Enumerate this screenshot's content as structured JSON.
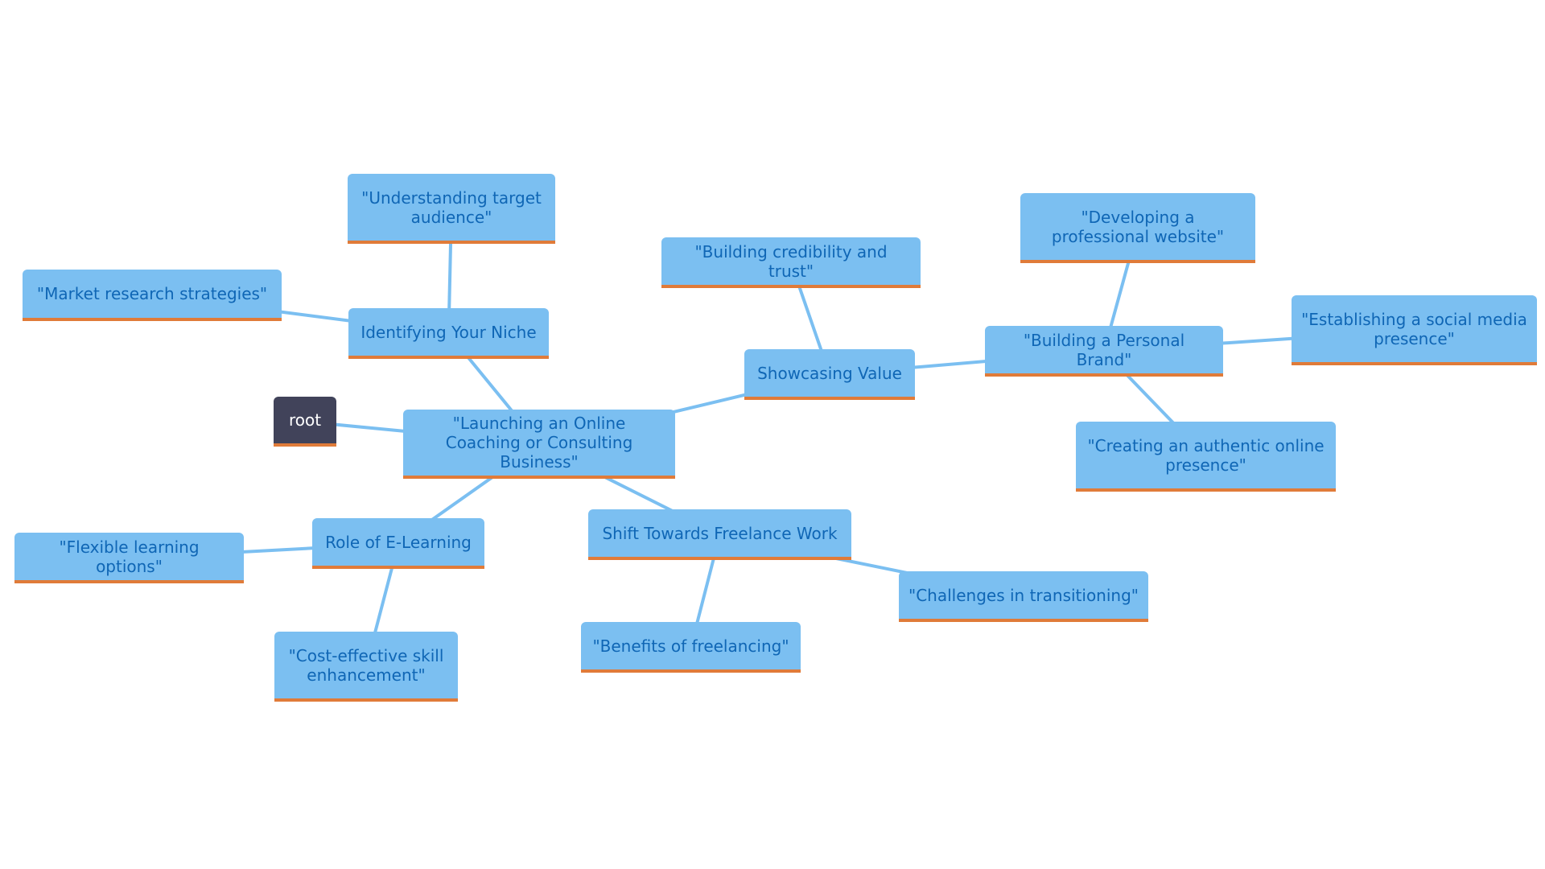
{
  "diagram": {
    "type": "mindmap",
    "colors": {
      "node_fill": "#7bbff1",
      "node_text": "#0f66b5",
      "node_underline": "#e07b39",
      "edge": "#7bbff1",
      "root_fill": "#41435a",
      "root_text": "#ffffff"
    },
    "nodes": [
      {
        "id": "root",
        "label": "root"
      },
      {
        "id": "center",
        "label": "\"Launching an Online Coaching or Consulting Business\""
      },
      {
        "id": "niche",
        "label": "Identifying Your Niche"
      },
      {
        "id": "audience",
        "label": "\"Understanding target audience\""
      },
      {
        "id": "market",
        "label": "\"Market research strategies\""
      },
      {
        "id": "elearn",
        "label": "Role of E-Learning"
      },
      {
        "id": "flexible",
        "label": "\"Flexible learning options\""
      },
      {
        "id": "cost",
        "label": "\"Cost-effective skill enhancement\""
      },
      {
        "id": "freelance",
        "label": "Shift Towards Freelance Work"
      },
      {
        "id": "benefits",
        "label": "\"Benefits of freelancing\""
      },
      {
        "id": "challenges",
        "label": "\"Challenges in transitioning\""
      },
      {
        "id": "value",
        "label": "Showcasing Value"
      },
      {
        "id": "credibility",
        "label": "\"Building credibility and trust\""
      },
      {
        "id": "brand",
        "label": "\"Building a Personal Brand\""
      },
      {
        "id": "website",
        "label": "\"Developing a professional website\""
      },
      {
        "id": "social",
        "label": "\"Establishing a social media presence\""
      },
      {
        "id": "authentic",
        "label": "\"Creating an authentic online presence\""
      }
    ],
    "edges": [
      [
        "root",
        "center"
      ],
      [
        "center",
        "niche"
      ],
      [
        "niche",
        "audience"
      ],
      [
        "niche",
        "market"
      ],
      [
        "center",
        "elearn"
      ],
      [
        "elearn",
        "flexible"
      ],
      [
        "elearn",
        "cost"
      ],
      [
        "center",
        "freelance"
      ],
      [
        "freelance",
        "benefits"
      ],
      [
        "freelance",
        "challenges"
      ],
      [
        "center",
        "value"
      ],
      [
        "value",
        "credibility"
      ],
      [
        "value",
        "brand"
      ],
      [
        "brand",
        "website"
      ],
      [
        "brand",
        "social"
      ],
      [
        "brand",
        "authentic"
      ]
    ]
  }
}
